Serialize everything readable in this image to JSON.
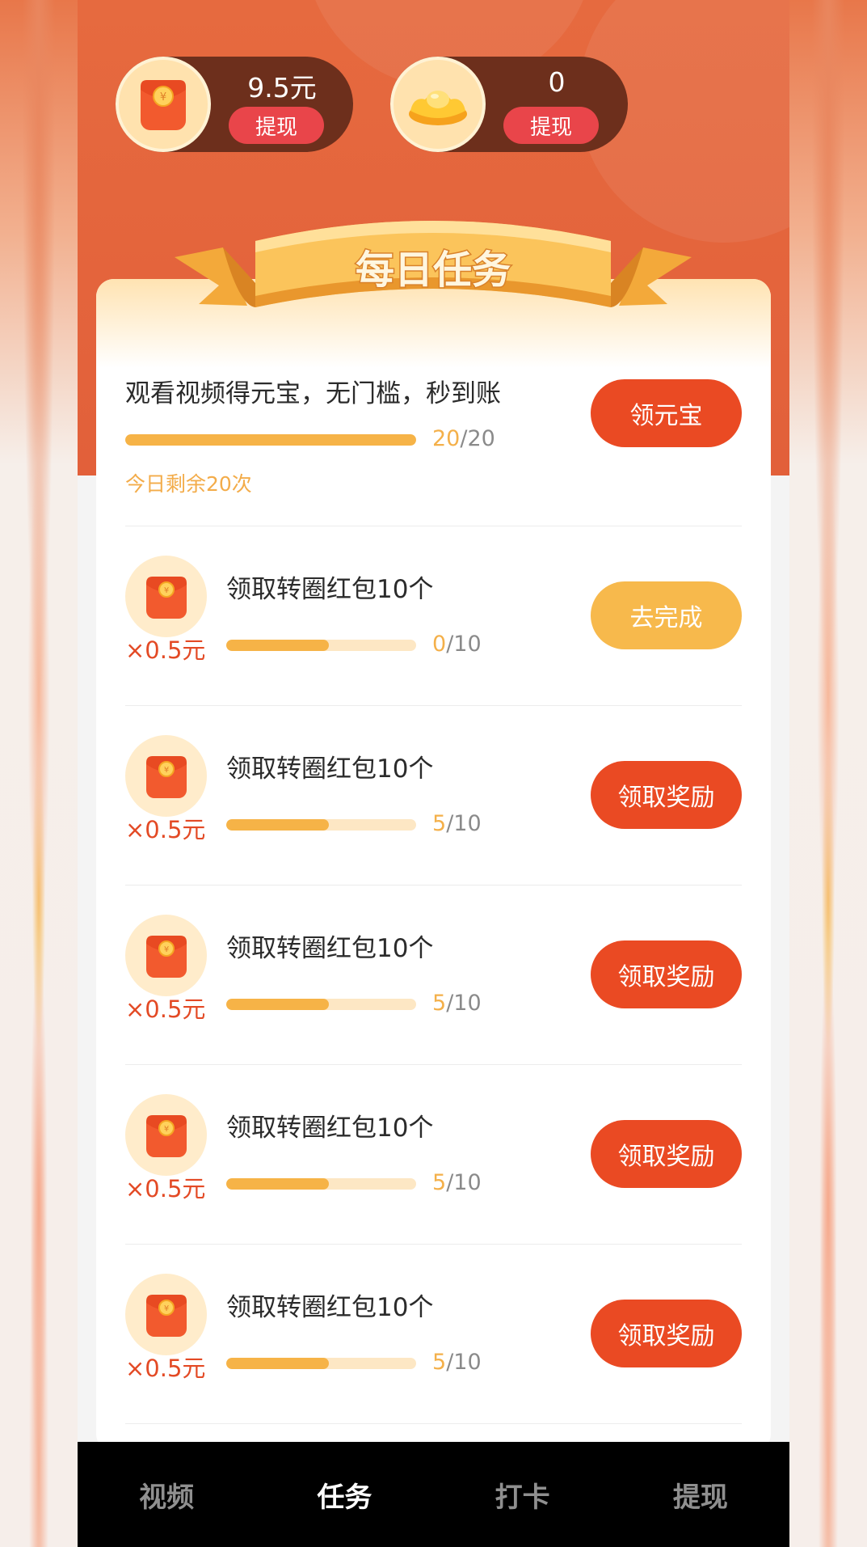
{
  "balances": [
    {
      "amount": "9.5元",
      "withdraw_label": "提现",
      "icon": "red-envelope-icon"
    },
    {
      "amount": "0",
      "withdraw_label": "提现",
      "icon": "gold-ingot-icon"
    }
  ],
  "banner": {
    "title": "每日任务"
  },
  "main_task": {
    "title": "观看视频得元宝，无门槛，秒到账",
    "progress": {
      "done": "20",
      "total": "/20",
      "fraction": 1.0
    },
    "remaining": "今日剩余20次",
    "button_label": "领元宝"
  },
  "tasks": [
    {
      "title": "领取转圈红包10个",
      "reward": "×0.5元",
      "done": "0",
      "total": "/10",
      "fraction": 0.54,
      "button_label": "去完成",
      "button_style": "yellow"
    },
    {
      "title": "领取转圈红包10个",
      "reward": "×0.5元",
      "done": "5",
      "total": "/10",
      "fraction": 0.54,
      "button_label": "领取奖励",
      "button_style": "red"
    },
    {
      "title": "领取转圈红包10个",
      "reward": "×0.5元",
      "done": "5",
      "total": "/10",
      "fraction": 0.54,
      "button_label": "领取奖励",
      "button_style": "red"
    },
    {
      "title": "领取转圈红包10个",
      "reward": "×0.5元",
      "done": "5",
      "total": "/10",
      "fraction": 0.54,
      "button_label": "领取奖励",
      "button_style": "red"
    },
    {
      "title": "领取转圈红包10个",
      "reward": "×0.5元",
      "done": "5",
      "total": "/10",
      "fraction": 0.54,
      "button_label": "领取奖励",
      "button_style": "red"
    }
  ],
  "tabbar": {
    "items": [
      {
        "label": "视频",
        "active": false
      },
      {
        "label": "任务",
        "active": true
      },
      {
        "label": "打卡",
        "active": false
      },
      {
        "label": "提现",
        "active": false
      }
    ]
  },
  "colors": {
    "header": "#e66a3f",
    "accent_red": "#ea4a23",
    "accent_yellow": "#f7b94c",
    "progress": "#f6b347"
  }
}
